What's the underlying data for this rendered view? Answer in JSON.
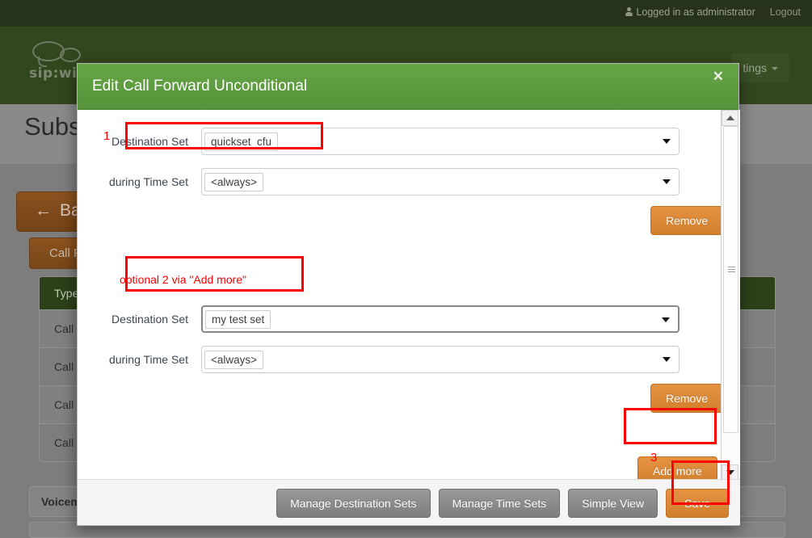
{
  "topbar": {
    "logged_in_text": "Logged in as administrator",
    "logout_label": "Logout",
    "user_icon": "user-icon"
  },
  "navbar": {
    "brand_text": "sip:wise",
    "settings_label": "tings",
    "caret_icon": "chevron-down-icon"
  },
  "page": {
    "title": "Subsc",
    "back_label": "Back",
    "back_arrow": "arrow-left-icon",
    "call_forward_button": "Call Fo",
    "table": {
      "headers": [
        "Type"
      ],
      "rows": [
        [
          "Call Fo"
        ],
        [
          "Call Fo"
        ],
        [
          "Call Fo"
        ],
        [
          "Call Fo"
        ]
      ]
    },
    "voicemail_label": "Voicem"
  },
  "modal": {
    "title": "Edit Call Forward Unconditional",
    "close_icon": "close-icon",
    "groups": [
      {
        "destination_label": "Destination Set",
        "destination_value": "quickset_cfu",
        "time_label": "during Time Set",
        "time_value": "<always>",
        "remove_label": "Remove",
        "dropdown_icon": "chevron-down-icon"
      },
      {
        "destination_label": "Destination Set",
        "destination_value": "my test set",
        "time_label": "during Time Set",
        "time_value": "<always>",
        "remove_label": "Remove",
        "dropdown_icon": "chevron-down-icon"
      }
    ],
    "add_more_label": "Add more",
    "annotations": {
      "num_one": "1",
      "optional_note": "optional 2 via \"Add more\"",
      "num_three": "3",
      "color": "#ff0000"
    },
    "footer": {
      "manage_destination_sets": "Manage Destination Sets",
      "manage_time_sets": "Manage Time Sets",
      "simple_view": "Simple View",
      "save": "Save"
    },
    "scrollbar": {
      "up_icon": "scroll-up-arrow-icon",
      "down_icon": "scroll-down-arrow-icon",
      "thumb": "scrollbar-thumb"
    }
  },
  "colors": {
    "header_green": "#5e9c40",
    "orange": "#d9872f",
    "annotation_red": "#ff0000",
    "nav_green": "#33471f"
  }
}
